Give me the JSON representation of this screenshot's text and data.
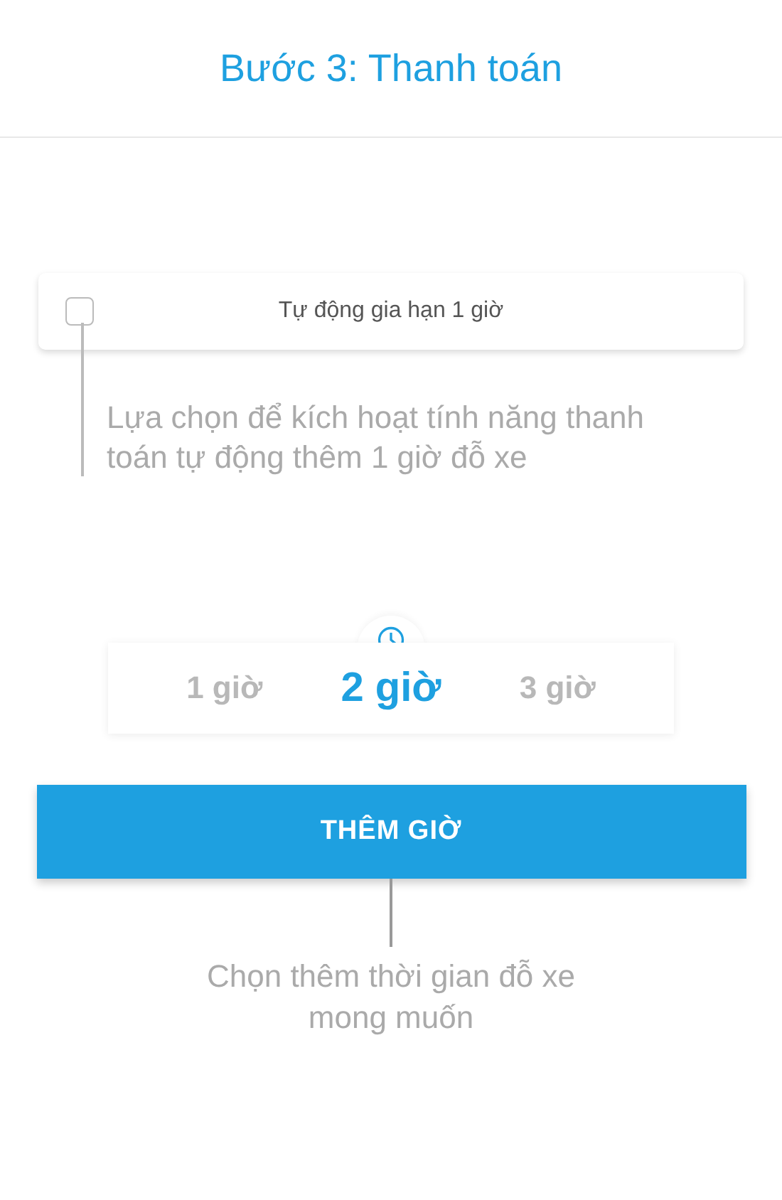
{
  "header": {
    "title": "Bước 3: Thanh toán"
  },
  "auto_renew": {
    "label": "Tự động gia hạn 1 giờ",
    "checked": false
  },
  "auto_renew_hint": "Lựa chọn để kích hoạt tính năng thanh toán tự động thêm 1 giờ đỗ xe",
  "hours": [
    {
      "label": "1 giờ",
      "selected": false
    },
    {
      "label": "2 giờ",
      "selected": true
    },
    {
      "label": "3 giờ",
      "selected": false
    }
  ],
  "add_button": "THÊM GIỜ",
  "add_hint": "Chọn thêm thời gian đỗ xe mong muốn"
}
